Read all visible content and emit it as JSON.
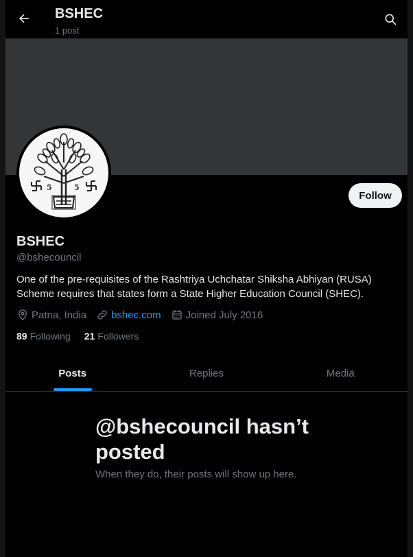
{
  "header": {
    "title": "BSHEC",
    "post_count": "1 post"
  },
  "profile": {
    "name": "BSHEC",
    "handle": "@bshecouncil",
    "bio": "One of the pre-requisites of the Rashtriya Uchchatar Shiksha Abhiyan (RUSA) Scheme requires that states form a State Higher Education Council (SHEC).",
    "location": "Patna, India",
    "website": "bshec.com",
    "joined": "Joined July 2016",
    "follow_label": "Follow"
  },
  "stats": {
    "following_count": "89",
    "following_label": "Following",
    "followers_count": "21",
    "followers_label": "Followers"
  },
  "tabs": [
    {
      "label": "Posts",
      "active": true
    },
    {
      "label": "Replies",
      "active": false
    },
    {
      "label": "Media",
      "active": false
    }
  ],
  "empty_state": {
    "title": "@bshecouncil hasn’t posted",
    "subtitle": "When they do, their posts will show up here."
  },
  "colors": {
    "background": "#000000",
    "banner": "#333639",
    "accent": "#1d9bf0",
    "muted_text": "#71767b",
    "primary_text": "#e7e9ea"
  },
  "icons": [
    "back-arrow-icon",
    "search-icon",
    "location-pin-icon",
    "link-icon",
    "calendar-icon"
  ]
}
